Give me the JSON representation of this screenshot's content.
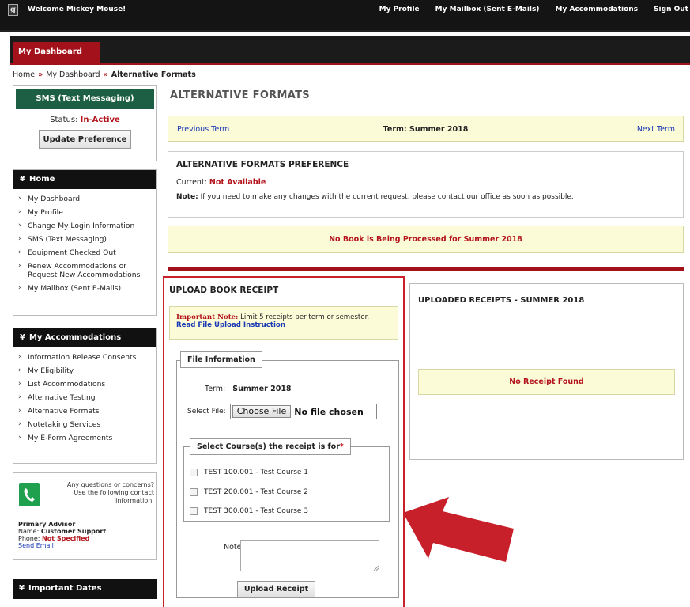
{
  "header": {
    "welcome_prefix": "Welcome",
    "user_name": "Mickey Mouse!",
    "nav": [
      "My Profile",
      "My Mailbox (Sent E-Mails)",
      "My Accommodations",
      "Sign Out"
    ]
  },
  "tabs": {
    "active": "My Dashboard"
  },
  "breadcrumb": {
    "home": "Home",
    "dashboard": "My Dashboard",
    "current": "Alternative Formats",
    "separator": "»"
  },
  "sidebar": {
    "sms": {
      "title": "SMS (Text Messaging)",
      "status_label": "Status:",
      "status_value": "In-Active",
      "button": "Update Preference"
    },
    "home": {
      "title": "Home",
      "items": [
        "My Dashboard",
        "My Profile",
        "Change My Login Information",
        "SMS (Text Messaging)",
        "Equipment Checked Out",
        "Renew Accommodations or Request New Accommodations",
        "My Mailbox (Sent E-Mails)"
      ]
    },
    "accommodations": {
      "title": "My Accommodations",
      "items": [
        "Information Release Consents",
        "My Eligibility",
        "List Accommodations",
        "Alternative Testing",
        "Alternative Formats",
        "Notetaking Services",
        "My E-Form Agreements"
      ]
    },
    "contact": {
      "text": "Any questions or concerns? Use the following contact information:",
      "advisor_heading": "Primary Advisor",
      "name_label": "Name:",
      "name_value": "Customer Support",
      "phone_label": "Phone:",
      "phone_value": "Not Specified",
      "email_link": "Send Email"
    },
    "dates": {
      "title": "Important Dates"
    }
  },
  "main": {
    "title": "ALTERNATIVE FORMATS",
    "term_nav": {
      "prev": "Previous Term",
      "current": "Term: Summer 2018",
      "next": "Next Term"
    },
    "preference": {
      "title": "ALTERNATIVE FORMATS PREFERENCE",
      "current_label": "Current:",
      "current_value": "Not Available",
      "note_label": "Note:",
      "note_text": "If you need to make any changes with the current request, please contact our office as soon as possible."
    },
    "processing_message": "No Book is Being Processed for Summer 2018",
    "upload": {
      "title": "UPLOAD BOOK RECEIPT",
      "important_label": "Important Note:",
      "important_text": "Limit 5 receipts per term or semester.",
      "instruction_link": "Read File Upload Instruction",
      "file_info_legend": "File Information",
      "term_label": "Term:",
      "term_value": "Summer 2018",
      "select_file_label": "Select File:",
      "choose_file_button": "Choose File",
      "file_status": "No file chosen",
      "course_legend": "Select Course(s) the receipt is for",
      "required_mark": "*",
      "courses": [
        "TEST 100.001 - Test Course 1",
        "TEST 200.001 - Test Course 2",
        "TEST 300.001 - Test Course 3"
      ],
      "note_label": "Note:",
      "upload_button": "Upload Receipt"
    },
    "receipts": {
      "title": "UPLOADED RECEIPTS - SUMMER 2018",
      "empty_message": "No Receipt Found"
    }
  },
  "colors": {
    "brand_red": "#a3121a",
    "sms_green": "#1d5f44",
    "highlight_yellow": "#fcfbd8",
    "arrow_red": "#c8202a"
  }
}
